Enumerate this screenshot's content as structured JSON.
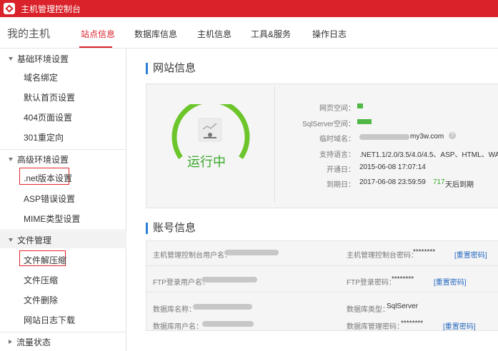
{
  "header": {
    "app_title": "主机管理控制台"
  },
  "nav": {
    "page_title": "我的主机",
    "tabs": [
      {
        "label": "站点信息",
        "active": true
      },
      {
        "label": "数据库信息",
        "active": false
      },
      {
        "label": "主机信息",
        "active": false
      },
      {
        "label": "工具&服务",
        "active": false
      },
      {
        "label": "操作日志",
        "active": false
      }
    ]
  },
  "sidebar": {
    "sections": [
      {
        "label": "基础环境设置",
        "expanded": true,
        "items": [
          "域名绑定",
          "默认首页设置",
          "404页面设置",
          "301重定向"
        ]
      },
      {
        "label": "高级环境设置",
        "expanded": true,
        "items": [
          ".net版本设置",
          "ASP错误设置",
          "MIME类型设置"
        ]
      },
      {
        "label": "文件管理",
        "expanded": true,
        "items": [
          "文件解压缩",
          "文件压缩",
          "文件删除",
          "网站日志下载"
        ]
      },
      {
        "label": "流量状态",
        "expanded": false,
        "items": []
      }
    ]
  },
  "site_info": {
    "section_title": "网站信息",
    "status": "运行中",
    "rows": [
      {
        "label": "网页空间：",
        "progress": 0.04
      },
      {
        "label": "SqlServer空间：",
        "progress": 0.1
      },
      {
        "label": "临时域名：",
        "value": "my3w.com"
      },
      {
        "label": "支持语言：",
        "value": ".NET1.1/2.0/3.5/4.0/4.5、ASP、HTML、WAP"
      },
      {
        "label": "开通日：",
        "value": "2015-06-08 17:07:14"
      },
      {
        "label": "到期日：",
        "value": "2017-06-08 23:59:59",
        "days": "717",
        "days_suffix": "天后到期"
      }
    ],
    "help_icon": "?"
  },
  "account_info": {
    "section_title": "账号信息",
    "rows": [
      {
        "label": "主机管理控制台用户名：",
        "right_label": "主机管理控制台密码：",
        "right_value": "********",
        "right_link": "[重置密码]"
      },
      {
        "label": "FTP登录用户名：",
        "right_label": "FTP登录密码：",
        "right_value": "********",
        "right_link": "[重置密码]"
      },
      {
        "label": "数据库名称：",
        "right_label": "数据库类型：",
        "right_value": "SqlServer"
      },
      {
        "label": "数据库用户名：",
        "right_label": "数据库管理密码：",
        "right_value": "********",
        "right_link": "[重置密码]"
      }
    ]
  },
  "colors": {
    "brand_red": "#d9222a",
    "status_green": "#51b848",
    "link_blue": "#2468c0"
  }
}
